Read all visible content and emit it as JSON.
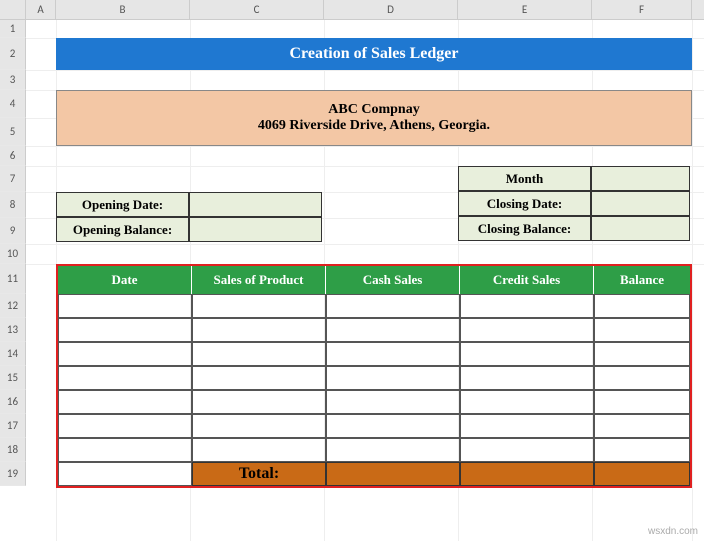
{
  "columns": [
    "A",
    "B",
    "C",
    "D",
    "E",
    "F"
  ],
  "rows": [
    "1",
    "2",
    "3",
    "4",
    "5",
    "6",
    "7",
    "8",
    "9",
    "10",
    "11",
    "12",
    "13",
    "14",
    "15",
    "16",
    "17",
    "18",
    "19"
  ],
  "title": "Creation of Sales Ledger",
  "company": {
    "name": "ABC Compnay",
    "address": "4069 Riverside Drive, Athens, Georgia."
  },
  "opening": {
    "date_label": "Opening Date:",
    "date_value": "",
    "balance_label": "Opening Balance:",
    "balance_value": ""
  },
  "month": {
    "header": "Month",
    "header_value": "",
    "closing_date_label": "Closing Date:",
    "closing_date_value": "",
    "closing_balance_label": "Closing Balance:",
    "closing_balance_value": ""
  },
  "ledger": {
    "headers": {
      "date": "Date",
      "sales_of_product": "Sales of Product",
      "cash_sales": "Cash Sales",
      "credit_sales": "Credit Sales",
      "balance": "Balance"
    },
    "rows": [
      {
        "date": "",
        "sales_of_product": "",
        "cash_sales": "",
        "credit_sales": "",
        "balance": ""
      },
      {
        "date": "",
        "sales_of_product": "",
        "cash_sales": "",
        "credit_sales": "",
        "balance": ""
      },
      {
        "date": "",
        "sales_of_product": "",
        "cash_sales": "",
        "credit_sales": "",
        "balance": ""
      },
      {
        "date": "",
        "sales_of_product": "",
        "cash_sales": "",
        "credit_sales": "",
        "balance": ""
      },
      {
        "date": "",
        "sales_of_product": "",
        "cash_sales": "",
        "credit_sales": "",
        "balance": ""
      },
      {
        "date": "",
        "sales_of_product": "",
        "cash_sales": "",
        "credit_sales": "",
        "balance": ""
      },
      {
        "date": "",
        "sales_of_product": "",
        "cash_sales": "",
        "credit_sales": "",
        "balance": ""
      }
    ],
    "total_label": "Total:",
    "total_values": {
      "sales_of_product": "",
      "cash_sales": "",
      "credit_sales": "",
      "balance": ""
    }
  },
  "watermark": "wsxdn.com"
}
